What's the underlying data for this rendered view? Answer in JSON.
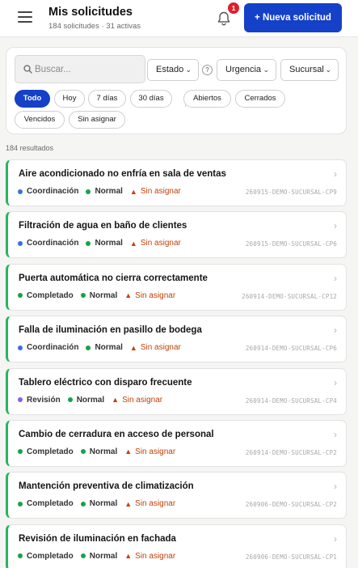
{
  "header": {
    "title": "Mis solicitudes",
    "subtitle": "184 solicitudes · 31 activas",
    "notification_count": "1",
    "new_button_label": "+ Nueva solicitud"
  },
  "filters": {
    "search_placeholder": "Buscar...",
    "estado": "Estado",
    "urgencia": "Urgencia",
    "sucursal": "Sucursal",
    "help": "?",
    "chips": {
      "todo": "Todo",
      "hoy": "Hoy",
      "dias7": "7 días",
      "dias30": "30 días",
      "abiertos": "Abiertos",
      "cerrados": "Cerrados",
      "vencidos": "Vencidos",
      "sin_asignar": "Sin asignar"
    }
  },
  "results_label": "184 resultados",
  "colors": {
    "accent": "#1540c8",
    "coordinacion": "#3b6fe0",
    "completado": "#16a34a",
    "revision": "#8b5cf6",
    "normal": "#16a34a",
    "warning": "#c2410c",
    "item_border": "#28b55a"
  },
  "items": [
    {
      "title": "Aire acondicionado no enfría en sala de ventas",
      "status": "Coordinación",
      "status_color": "#3b6fe0",
      "urgency": "Normal",
      "assign": "Sin asignar",
      "code": "260915-DEMO-SUCURSAL-CP9"
    },
    {
      "title": "Filtración de agua en baño de clientes",
      "status": "Coordinación",
      "status_color": "#3b6fe0",
      "urgency": "Normal",
      "assign": "Sin asignar",
      "code": "260915-DEMO-SUCURSAL-CP6"
    },
    {
      "title": "Puerta automática no cierra correctamente",
      "status": "Completado",
      "status_color": "#16a34a",
      "urgency": "Normal",
      "assign": "Sin asignar",
      "code": "260914-DEMO-SUCURSAL-CP12"
    },
    {
      "title": "Falla de iluminación en pasillo de bodega",
      "status": "Coordinación",
      "status_color": "#3b6fe0",
      "urgency": "Normal",
      "assign": "Sin asignar",
      "code": "260914-DEMO-SUCURSAL-CP6"
    },
    {
      "title": "Tablero eléctrico con disparo frecuente",
      "status": "Revisión",
      "status_color": "#8b5cf6",
      "urgency": "Normal",
      "assign": "Sin asignar",
      "code": "260914-DEMO-SUCURSAL-CP4"
    },
    {
      "title": "Cambio de cerradura en acceso de personal",
      "status": "Completado",
      "status_color": "#16a34a",
      "urgency": "Normal",
      "assign": "Sin asignar",
      "code": "260914-DEMO-SUCURSAL-CP2"
    },
    {
      "title": "Mantención preventiva de climatización",
      "status": "Completado",
      "status_color": "#16a34a",
      "urgency": "Normal",
      "assign": "Sin asignar",
      "code": "260906-DEMO-SUCURSAL-CP2"
    },
    {
      "title": "Revisión de iluminación en fachada",
      "status": "Completado",
      "status_color": "#16a34a",
      "urgency": "Normal",
      "assign": "Sin asignar",
      "code": "260906-DEMO-SUCURSAL-CP1"
    }
  ]
}
